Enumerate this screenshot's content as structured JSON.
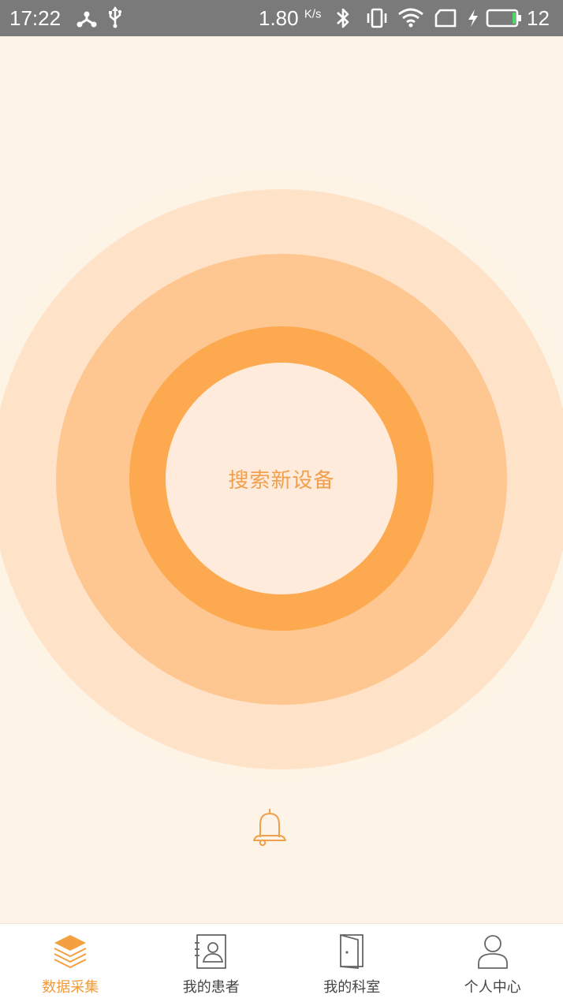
{
  "status_bar": {
    "time": "17:22",
    "speed_value": "1.80",
    "speed_unit": "K/s",
    "battery_level": "12"
  },
  "main": {
    "search_button_label": "搜索新设备",
    "bell_icon": "bell-icon"
  },
  "bottom_nav": {
    "items": [
      {
        "label": "数据采集",
        "icon": "layers-icon",
        "active": true
      },
      {
        "label": "我的患者",
        "icon": "patient-card-icon",
        "active": false
      },
      {
        "label": "我的科室",
        "icon": "door-icon",
        "active": false
      },
      {
        "label": "个人中心",
        "icon": "user-icon",
        "active": false
      }
    ]
  },
  "colors": {
    "accent": "#f09a3a",
    "ring_outer": "#fee3c8",
    "ring_mid": "#fec690",
    "ring_inner": "#fda94f",
    "center": "#feebdb",
    "status_bar": "#7a7a7a"
  }
}
